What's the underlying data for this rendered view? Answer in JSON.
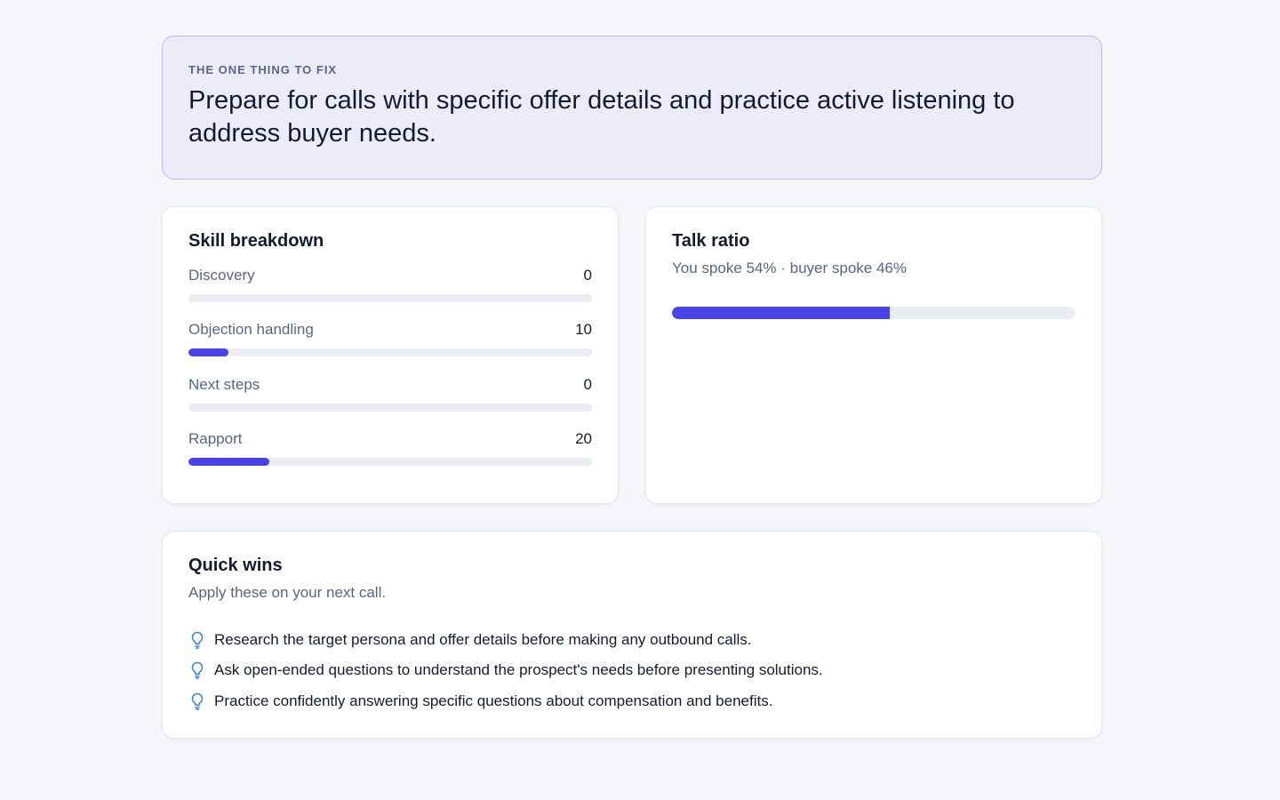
{
  "focus": {
    "eyebrow": "THE ONE THING TO FIX",
    "text": "Prepare for calls with specific offer details and practice active listening to address buyer needs."
  },
  "skills": {
    "title": "Skill breakdown",
    "max_score": 100,
    "items": [
      {
        "name": "Discovery",
        "score": "0",
        "value": 0
      },
      {
        "name": "Objection handling",
        "score": "10",
        "value": 10
      },
      {
        "name": "Next steps",
        "score": "0",
        "value": 0
      },
      {
        "name": "Rapport",
        "score": "20",
        "value": 20
      }
    ]
  },
  "talk": {
    "title": "Talk ratio",
    "subtitle": "You spoke 54% · buyer spoke 46%",
    "you_percent": 54
  },
  "wins": {
    "title": "Quick wins",
    "subtitle": "Apply these on your next call.",
    "icon": "lightbulb-icon",
    "items": [
      "Research the target persona and offer details before making any outbound calls.",
      "Ask open-ended questions to understand the prospect's needs before presenting solutions.",
      "Practice confidently answering specific questions about compensation and benefits."
    ]
  },
  "colors": {
    "accent": "#4a44e8",
    "track": "#ebedf2",
    "icon": "#3b86c9"
  }
}
